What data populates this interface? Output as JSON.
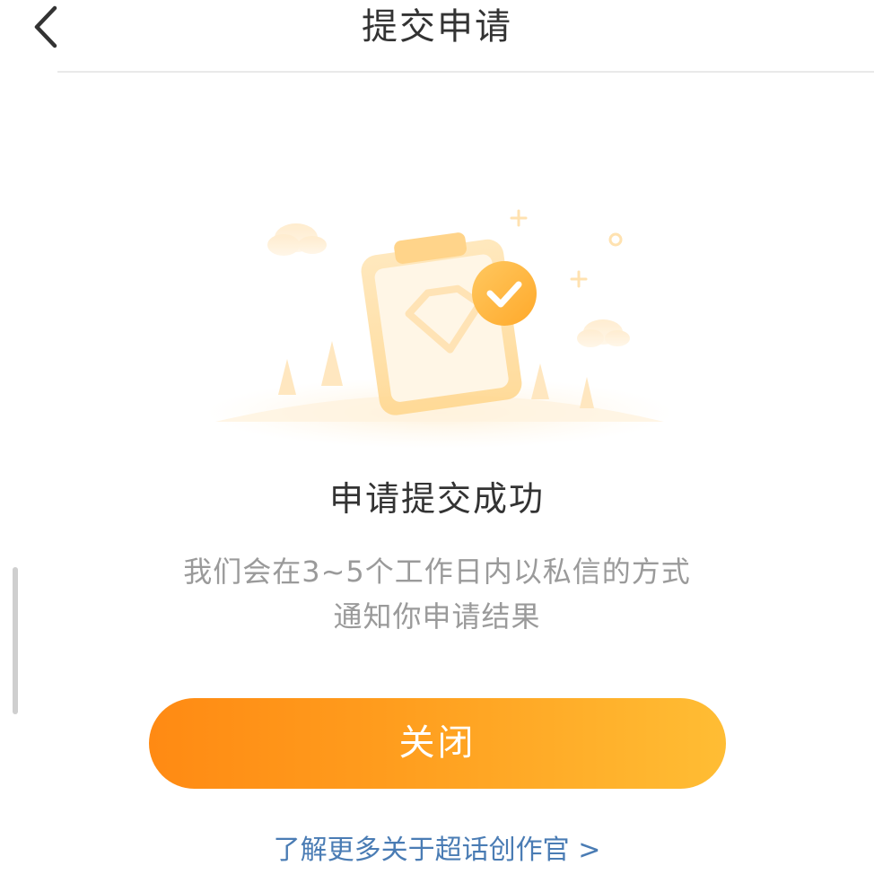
{
  "header": {
    "title": "提交申请",
    "back_icon": "chevron-left-icon"
  },
  "illustration": {
    "icon": "clipboard-success-illustration",
    "accent_color": "#ffb02e"
  },
  "result": {
    "title": "申请提交成功",
    "desc_line1": "我们会在3~5个工作日内以私信的方式",
    "desc_line2": "通知你申请结果"
  },
  "actions": {
    "close_label": "关闭",
    "learn_more_label": "了解更多关于超话创作官 >"
  },
  "colors": {
    "button_gradient_start": "#ff8a13",
    "button_gradient_end": "#ffbd34",
    "link": "#4a7cb4"
  }
}
